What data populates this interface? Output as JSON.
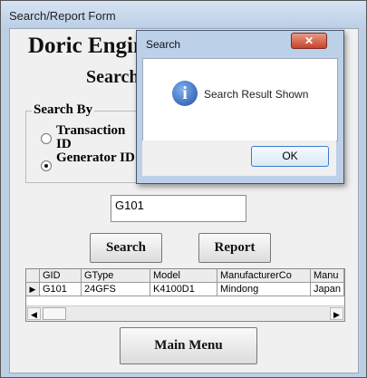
{
  "main_window": {
    "title": "Search/Report Form"
  },
  "form": {
    "company_name": "Doric Engineering Pvt.",
    "heading": "Search",
    "search_by": {
      "legend": "Search By",
      "options": [
        {
          "label": "Transaction ID",
          "selected": false
        },
        {
          "label": "Generator ID",
          "selected": true
        }
      ]
    },
    "search_value": "G101",
    "buttons": {
      "search": "Search",
      "report": "Report",
      "main_menu": "Main Menu"
    }
  },
  "grid": {
    "columns": [
      "GID",
      "GType",
      "Model",
      "ManufacturerCo",
      "Manu"
    ],
    "rows": [
      [
        "G101",
        "24GFS",
        "K4100D1",
        "Mindong",
        "Japan"
      ]
    ],
    "selector_glyph": "▶"
  },
  "dialog": {
    "title": "Search",
    "close_glyph": "✕",
    "icon": "info-icon",
    "message": "Search Result Shown",
    "ok_label": "OK"
  }
}
